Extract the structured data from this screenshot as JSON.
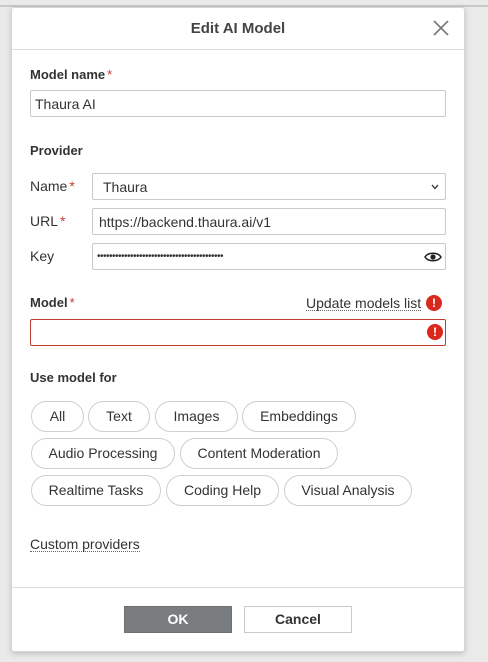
{
  "dialog": {
    "title": "Edit AI Model",
    "close_icon": "close-icon"
  },
  "model_name": {
    "label": "Model name",
    "required_mark": "*",
    "value": "Thaura AI"
  },
  "provider": {
    "section_label": "Provider",
    "name": {
      "label": "Name",
      "required_mark": "*",
      "value": "Thaura"
    },
    "url": {
      "label": "URL",
      "required_mark": "*",
      "value": "https://backend.thaura.ai/v1"
    },
    "key": {
      "label": "Key",
      "value": "••••••••••••••••••••••••••••••••••••••••••"
    }
  },
  "model": {
    "label": "Model",
    "required_mark": "*",
    "update_link": "Update models list",
    "value": "",
    "error_icon": "!"
  },
  "use_model_for": {
    "label": "Use model for",
    "chips": [
      "All",
      "Text",
      "Images",
      "Embeddings",
      "Audio Processing",
      "Content Moderation",
      "Realtime Tasks",
      "Coding Help",
      "Visual Analysis"
    ]
  },
  "custom_providers_link": "Custom providers",
  "buttons": {
    "ok": "OK",
    "cancel": "Cancel"
  },
  "colors": {
    "required": "#c43b2e",
    "error": "#d9281c",
    "ok_button": "#7a7d80"
  }
}
